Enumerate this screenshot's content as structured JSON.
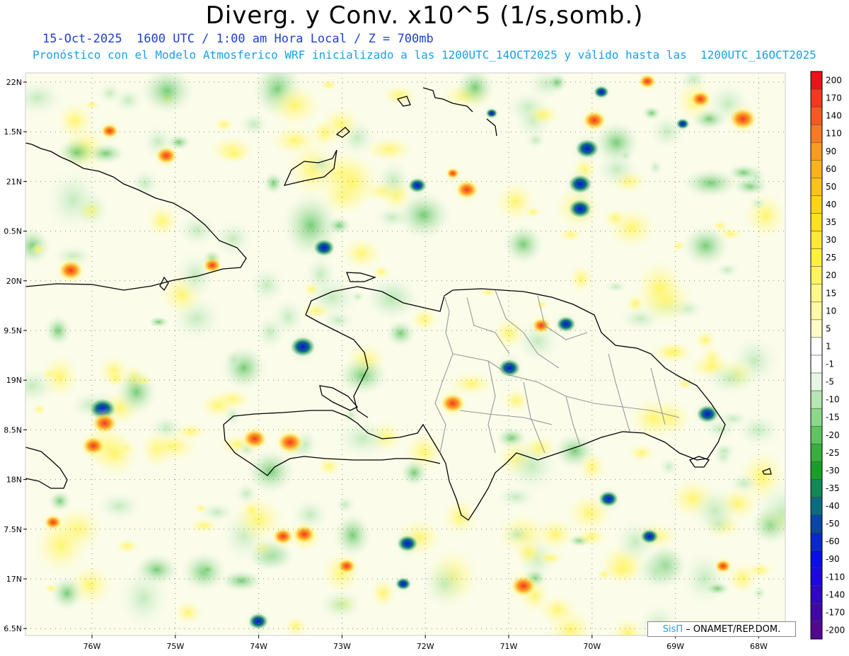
{
  "header": {
    "title": "Diverg. y Conv. x10^5 (1/s,somb.)",
    "subtitle1": "15-Oct-2025  1600 UTC / 1:00 am Hora Local / Z = 700mb",
    "subtitle2": "Pronóstico con el Modelo Atmosferico WRF inicializado a las 1200UTC_14OCT2025 y válido hasta las  1200UTC_16OCT2025"
  },
  "axes": {
    "lat_labels": [
      "22N",
      "1.5N",
      "21N",
      "0.5N",
      "20N",
      "9.5N",
      "19N",
      "8.5N",
      "18N",
      "7.5N",
      "17N",
      "6.5N"
    ],
    "lon_labels": [
      "76W",
      "75W",
      "74W",
      "73W",
      "72W",
      "71W",
      "70W",
      "69W",
      "68W"
    ]
  },
  "colorbar": {
    "levels": [
      {
        "label": "200",
        "color": "#e8141a"
      },
      {
        "label": "170",
        "color": "#f03a1e"
      },
      {
        "label": "140",
        "color": "#f65a20"
      },
      {
        "label": "110",
        "color": "#fa7a22"
      },
      {
        "label": "90",
        "color": "#fc9a24"
      },
      {
        "label": "60",
        "color": "#ffb022"
      },
      {
        "label": "50",
        "color": "#ffc020"
      },
      {
        "label": "40",
        "color": "#ffd21e"
      },
      {
        "label": "35",
        "color": "#ffe024"
      },
      {
        "label": "30",
        "color": "#ffe83a"
      },
      {
        "label": "25",
        "color": "#fff040"
      },
      {
        "label": "20",
        "color": "#fff45e"
      },
      {
        "label": "15",
        "color": "#fff886"
      },
      {
        "label": "10",
        "color": "#fffaa6"
      },
      {
        "label": "5",
        "color": "#fffcc8"
      },
      {
        "label": "1",
        "color": "#ffffff"
      },
      {
        "label": "-1",
        "color": "#ffffff"
      },
      {
        "label": "-5",
        "color": "#e6f6e4"
      },
      {
        "label": "-10",
        "color": "#b6e6b2"
      },
      {
        "label": "-15",
        "color": "#8cd88a"
      },
      {
        "label": "-20",
        "color": "#5ec462"
      },
      {
        "label": "-25",
        "color": "#34b03c"
      },
      {
        "label": "-30",
        "color": "#16a02a"
      },
      {
        "label": "-35",
        "color": "#0e8a56"
      },
      {
        "label": "-40",
        "color": "#0a6c80"
      },
      {
        "label": "-50",
        "color": "#0846a8"
      },
      {
        "label": "-60",
        "color": "#0a28c8"
      },
      {
        "label": "-90",
        "color": "#0a10e0"
      },
      {
        "label": "-110",
        "color": "#1c08d8"
      },
      {
        "label": "-140",
        "color": "#3008c0"
      },
      {
        "label": "-170",
        "color": "#4008a8"
      },
      {
        "label": "-200",
        "color": "#520890"
      }
    ]
  },
  "credit": {
    "brand": "SisΠ",
    "org": "– ONAMET/REP.DOM."
  }
}
